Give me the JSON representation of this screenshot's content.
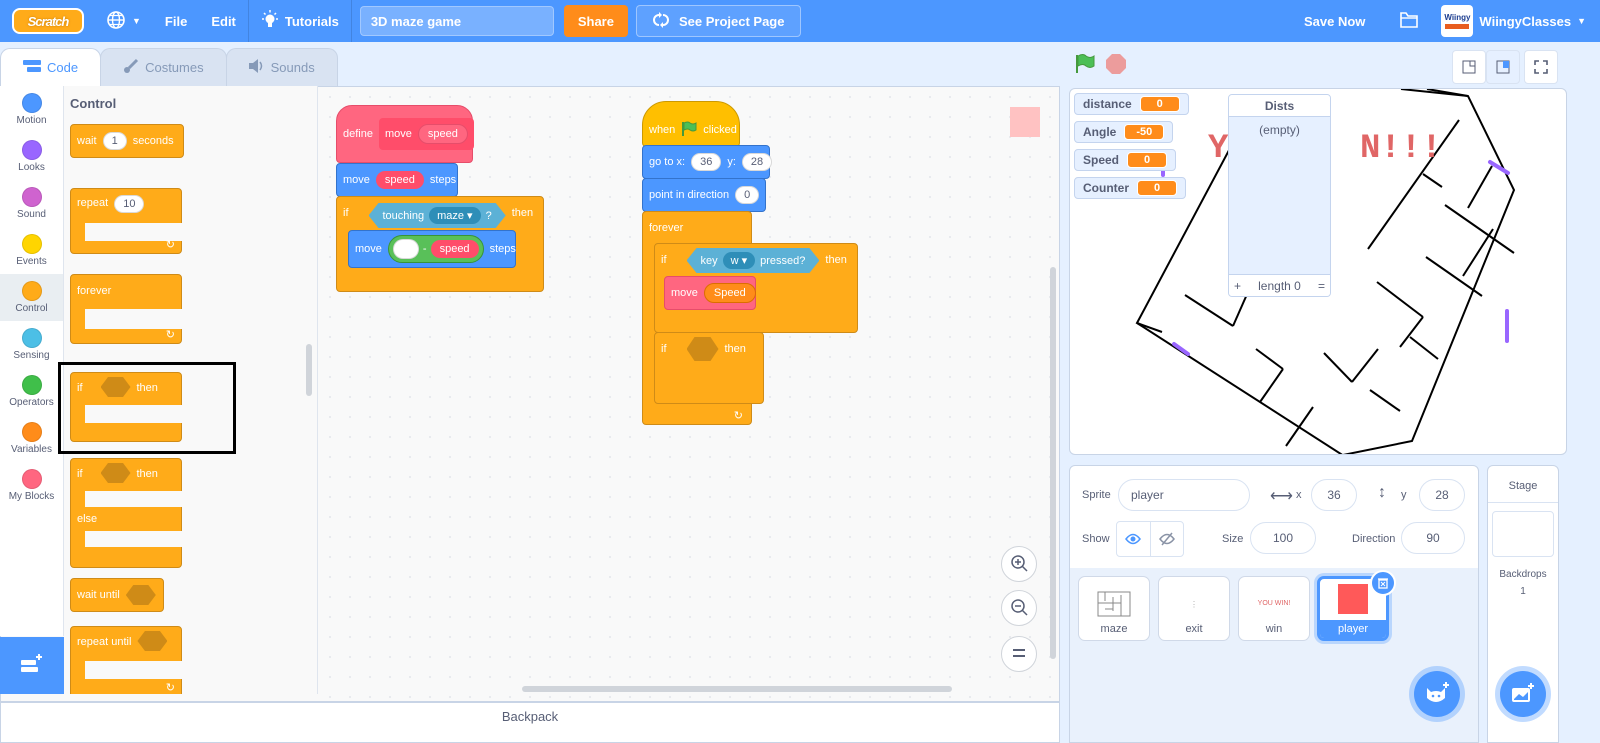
{
  "menubar": {
    "logo": "Scratch",
    "file": "File",
    "edit": "Edit",
    "tutorials": "Tutorials",
    "project_title": "3D maze game",
    "share": "Share",
    "see_project_page": "See Project Page",
    "save_now": "Save Now",
    "username": "WiingyClasses",
    "avatar_text": "Wiingy"
  },
  "tabs": {
    "code": "Code",
    "costumes": "Costumes",
    "sounds": "Sounds"
  },
  "categories": [
    {
      "label": "Motion",
      "color": "#4c97ff"
    },
    {
      "label": "Looks",
      "color": "#9966ff"
    },
    {
      "label": "Sound",
      "color": "#cf63cf"
    },
    {
      "label": "Events",
      "color": "#ffd500"
    },
    {
      "label": "Control",
      "color": "#ffab19"
    },
    {
      "label": "Sensing",
      "color": "#4cbfe6"
    },
    {
      "label": "Operators",
      "color": "#40bf4a"
    },
    {
      "label": "Variables",
      "color": "#ff8c1a"
    },
    {
      "label": "My Blocks",
      "color": "#ff6680"
    }
  ],
  "palette": {
    "title": "Control",
    "wait": "wait",
    "wait_value": "1",
    "seconds": "seconds",
    "repeat": "repeat",
    "repeat_value": "10",
    "forever": "forever",
    "if": "if",
    "then": "then",
    "else": "else",
    "wait_until": "wait until",
    "repeat_until": "repeat until"
  },
  "script1": {
    "define": "define",
    "move": "move",
    "speed": "speed",
    "steps": "steps",
    "if": "if",
    "touching": "touching",
    "maze": "maze",
    "question": "?",
    "then": "then",
    "minus": "-",
    "empty_value": ""
  },
  "script2": {
    "when": "when",
    "clicked": "clicked",
    "goto": "go to x:",
    "x_value": "36",
    "y_label": "y:",
    "y_value": "28",
    "point": "point in direction",
    "direction_value": "0",
    "forever": "forever",
    "if": "if",
    "key": "key",
    "key_value": "w",
    "pressed": "pressed?",
    "then": "then",
    "move": "move",
    "speed_var": "Speed"
  },
  "backpack": "Backpack",
  "monitors": [
    {
      "name": "distance",
      "value": "0"
    },
    {
      "name": "Angle",
      "value": "-50"
    },
    {
      "name": "Speed",
      "value": "0"
    },
    {
      "name": "Counter",
      "value": "0"
    }
  ],
  "list_monitor": {
    "title": "Dists",
    "empty": "(empty)",
    "add": "+",
    "length": "length 0",
    "resize": "="
  },
  "sprite_info": {
    "sprite_label": "Sprite",
    "sprite_name": "player",
    "x_label": "x",
    "x": "36",
    "y_label": "y",
    "y": "28",
    "show_label": "Show",
    "size_label": "Size",
    "size": "100",
    "direction_label": "Direction",
    "direction": "90"
  },
  "sprites": [
    {
      "name": "maze",
      "selected": false
    },
    {
      "name": "exit",
      "selected": false
    },
    {
      "name": "win",
      "selected": false,
      "thumb_text": "YOU WIN!"
    },
    {
      "name": "player",
      "selected": true
    }
  ],
  "stage_pane": {
    "title": "Stage",
    "backdrops_label": "Backdrops",
    "backdrops_count": "1"
  }
}
